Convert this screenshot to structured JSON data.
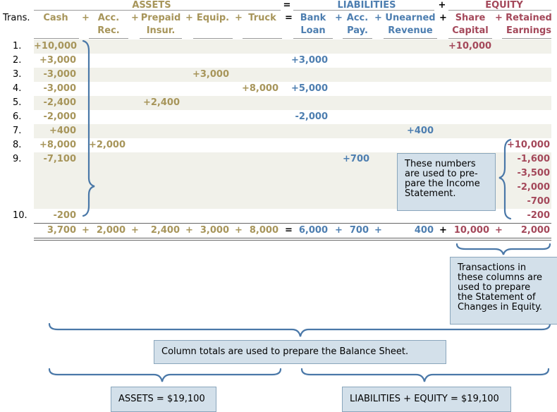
{
  "groups": {
    "assets": "ASSETS",
    "eq1": "=",
    "liabilities": "LIABILITIES",
    "plus1": "+",
    "equity": "EQUITY"
  },
  "headers": {
    "trans": "Trans.",
    "cash": "Cash",
    "acc_rec": [
      "Acc.",
      "Rec."
    ],
    "prepaid": [
      "Prepaid",
      "Insur."
    ],
    "equip": "Equip.",
    "truck": "Truck",
    "bank": [
      "Bank",
      "Loan"
    ],
    "acc_pay": [
      "Acc.",
      "Pay."
    ],
    "unearned": [
      "Unearned",
      "Revenue"
    ],
    "share": [
      "Share",
      "Capital"
    ],
    "retained": [
      "Retained",
      "Earnings"
    ]
  },
  "ops": {
    "plus": "+",
    "eq": "="
  },
  "rows": [
    {
      "n": "1.",
      "cash": "+10,000",
      "share": "+10,000"
    },
    {
      "n": "2.",
      "cash": "+3,000",
      "bank": "+3,000"
    },
    {
      "n": "3.",
      "cash": "-3,000",
      "equip": "+3,000"
    },
    {
      "n": "4.",
      "cash": "-3,000",
      "truck": "+8,000",
      "bank": "+5,000"
    },
    {
      "n": "5.",
      "cash": "-2,400",
      "prepaid": "+2,400"
    },
    {
      "n": "6.",
      "cash": "-2,000",
      "bank": "-2,000"
    },
    {
      "n": "7.",
      "cash": "+400",
      "unearned": "+400"
    },
    {
      "n": "8.",
      "cash": "+8,000",
      "acc_rec": "+2,000",
      "retained": "+10,000"
    },
    {
      "n": "9.",
      "cash": "-7,100",
      "acc_pay": "+700",
      "retained": "-1,600"
    },
    {
      "n": "",
      "retained": "-3,500"
    },
    {
      "n": "",
      "retained": "-2,000"
    },
    {
      "n": "",
      "retained": "-700"
    },
    {
      "n": "10.",
      "cash": "-200",
      "retained": "-200"
    }
  ],
  "totals": {
    "cash": "3,700",
    "acc_rec": "2,000",
    "prepaid": "2,400",
    "equip": "3,000",
    "truck": "8,000",
    "bank": "6,000",
    "acc_pay": "700",
    "unearned": "400",
    "share": "10,000",
    "retained": "2,000"
  },
  "notes": {
    "income": [
      "These numbers",
      "are used to pre-",
      "pare the Income",
      "Statement."
    ],
    "equity": [
      "Transactions in",
      "these columns are",
      "used to prepare",
      "the Statement of",
      "Changes in Equity."
    ],
    "balance": "Column totals are used to prepare the Balance Sheet.",
    "assets_total": "ASSETS = $19,100",
    "liab_eq_total": "LIABILITIES + EQUITY = $19,100"
  },
  "colors": {
    "assets": "#a7955a",
    "liabilities": "#4d7eb0",
    "equity": "#a4485a",
    "box": "#d3e0ea",
    "brace": "#4a78a8"
  }
}
